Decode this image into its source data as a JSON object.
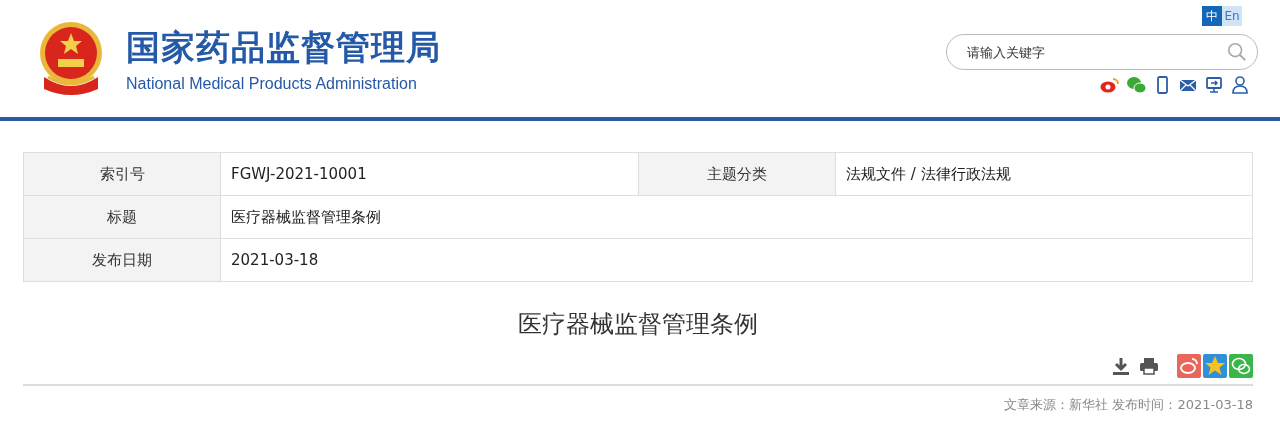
{
  "header": {
    "title": "国家药品监督管理局",
    "subtitle": "National Medical Products Administration",
    "languages": [
      {
        "label": "中",
        "selected": true
      },
      {
        "label": "En",
        "selected": false
      }
    ],
    "search": {
      "placeholder": "请输入关键字"
    },
    "social_icons": [
      {
        "kind": "weibo"
      },
      {
        "kind": "wechat"
      },
      {
        "kind": "mobile"
      },
      {
        "kind": "mail"
      },
      {
        "kind": "screen"
      },
      {
        "kind": "user"
      }
    ]
  },
  "info_table": {
    "rows": [
      {
        "cells": [
          {
            "label": "索引号",
            "value": "FGWJ-2021-10001"
          },
          {
            "label": "主题分类",
            "value": "法规文件 / 法律行政法规"
          }
        ]
      },
      {
        "cells": [
          {
            "label": "标题",
            "value": "医疗器械监督管理条例"
          }
        ]
      },
      {
        "cells": [
          {
            "label": "发布日期",
            "value": "2021-03-18"
          }
        ]
      }
    ]
  },
  "article": {
    "title": "医疗器械监督管理条例",
    "tools": [
      {
        "kind": "download"
      },
      {
        "kind": "print"
      }
    ],
    "share": [
      {
        "kind": "weibo"
      },
      {
        "kind": "qzone"
      },
      {
        "kind": "wechat"
      }
    ],
    "meta": "文章来源：新华社 发布时间：2021-03-18"
  }
}
